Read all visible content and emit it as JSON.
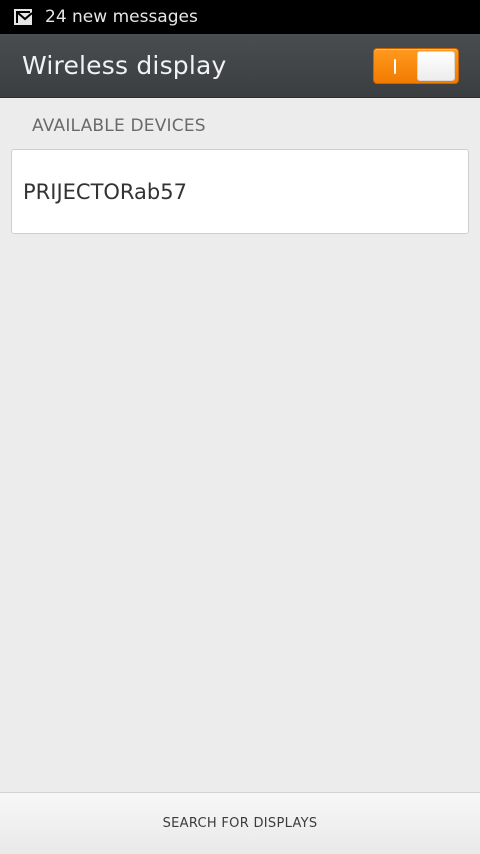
{
  "status_bar": {
    "notification_icon": "gmail-notification-icon",
    "text": "24 new messages"
  },
  "app_bar": {
    "title": "Wireless display",
    "toggle_state": "on",
    "accent_color": "#f5850a"
  },
  "devices_section": {
    "header": "AVAILABLE DEVICES",
    "devices": [
      {
        "name": "PRIJECTORab57"
      }
    ]
  },
  "bottom_action": {
    "label": "SEARCH FOR DISPLAYS"
  }
}
